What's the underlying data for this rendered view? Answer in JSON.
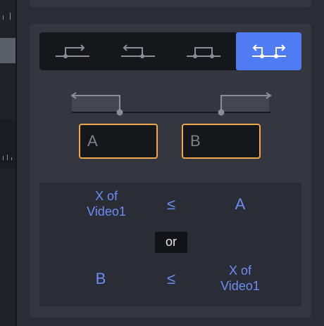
{
  "fields": {
    "a_placeholder": "A",
    "b_placeholder": "B"
  },
  "expression": {
    "row1": {
      "left": "X of\nVideo1",
      "operator": "≤",
      "right": "A"
    },
    "conjunction": "or",
    "row2": {
      "left": "B",
      "operator": "≤",
      "right": "X of\nVideo1"
    }
  },
  "colors": {
    "accent": "#4f7cf3",
    "field_border": "#f0a84a",
    "expression_text": "#6b8df5"
  },
  "segment_modes": [
    "step-up-icon",
    "step-down-icon",
    "pulse-icon",
    "double-step-icon"
  ],
  "active_mode": 3
}
